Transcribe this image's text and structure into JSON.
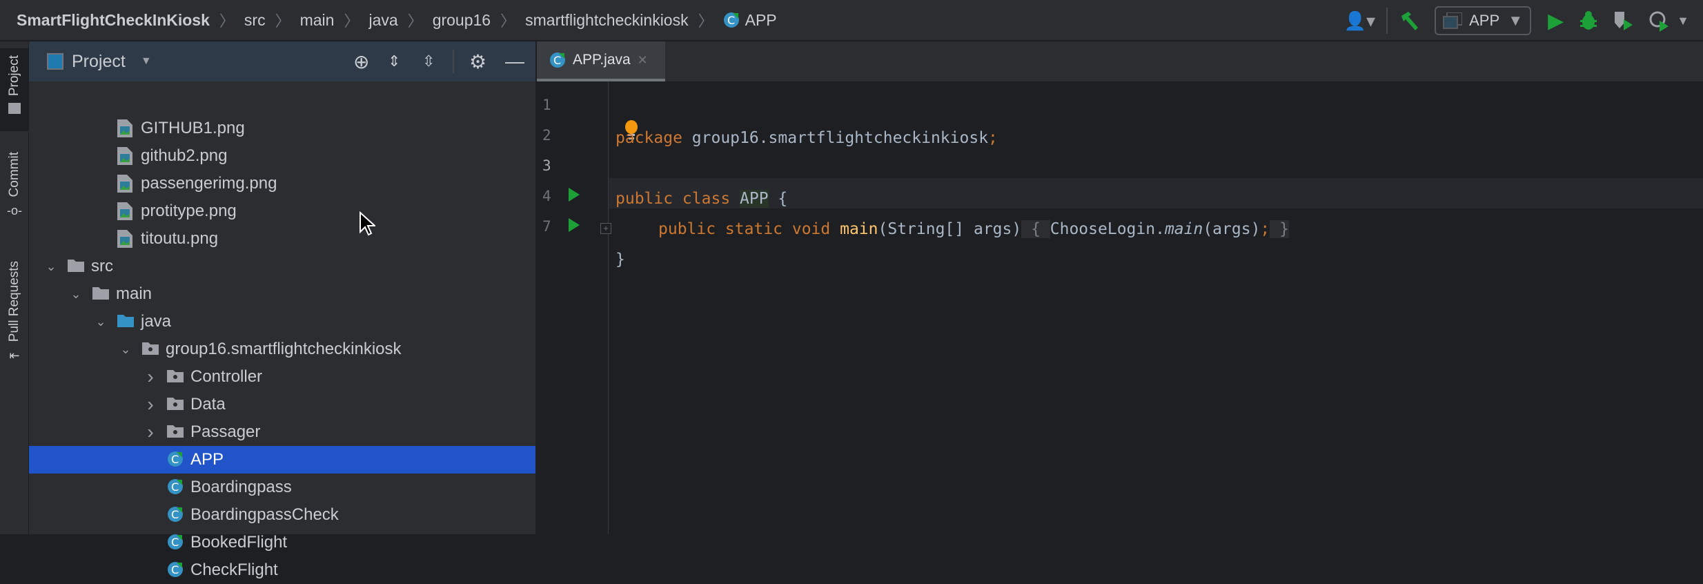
{
  "breadcrumb": [
    "SmartFlightCheckInKiosk",
    "src",
    "main",
    "java",
    "group16",
    "smartflightcheckinkiosk",
    "APP"
  ],
  "toolbar": {
    "run_config": "APP"
  },
  "stripe": {
    "project": "Project",
    "commit": "Commit",
    "pull_requests": "Pull Requests"
  },
  "panel": {
    "title": "Project"
  },
  "tree": [
    {
      "label": "GITHUB1.png",
      "type": "image",
      "depth": 3
    },
    {
      "label": "github2.png",
      "type": "image",
      "depth": 3
    },
    {
      "label": "passengerimg.png",
      "type": "image",
      "depth": 3
    },
    {
      "label": "protitype.png",
      "type": "image",
      "depth": 3
    },
    {
      "label": "titoutu.png",
      "type": "image",
      "depth": 3
    },
    {
      "label": "src",
      "type": "folder",
      "depth": 1,
      "expanded": true
    },
    {
      "label": "main",
      "type": "folder",
      "depth": 2,
      "expanded": true
    },
    {
      "label": "java",
      "type": "srcfolder",
      "depth": 3,
      "expanded": true
    },
    {
      "label": "group16.smartflightcheckinkiosk",
      "type": "package",
      "depth": 4,
      "expanded": true
    },
    {
      "label": "Controller",
      "type": "package",
      "depth": 5,
      "expanded": false
    },
    {
      "label": "Data",
      "type": "package",
      "depth": 5,
      "expanded": false
    },
    {
      "label": "Passager",
      "type": "package",
      "depth": 5,
      "expanded": false
    },
    {
      "label": "APP",
      "type": "class",
      "depth": 5,
      "selected": true
    },
    {
      "label": "Boardingpass",
      "type": "class",
      "depth": 5
    },
    {
      "label": "BoardingpassCheck",
      "type": "class",
      "depth": 5
    },
    {
      "label": "BookedFlight",
      "type": "class",
      "depth": 5
    },
    {
      "label": "CheckFlight",
      "type": "class",
      "depth": 5
    }
  ],
  "editor": {
    "tab": "APP.java",
    "line_numbers": [
      "1",
      "2",
      "3",
      "4",
      "7"
    ],
    "lines": {
      "l1": {
        "kw": "package",
        "rest": " group16.smartflightcheckinkiosk",
        "semi": ";"
      },
      "l3": {
        "kw": "public class",
        "name": "APP",
        "rest": " {"
      },
      "l4": {
        "kw": "public static void",
        "fn": "main",
        "params": "(String[] args)",
        "open": " { ",
        "call": "ChooseLogin.",
        "callfn": "main",
        "args": "(args)",
        "semi": ";",
        "close": " }"
      },
      "l7": {
        "rest": "}"
      }
    }
  }
}
